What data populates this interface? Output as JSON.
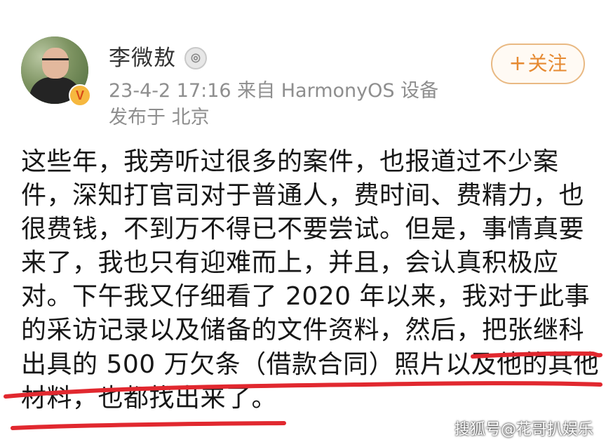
{
  "post": {
    "username": "李微敖",
    "follow_button": {
      "icon": "+",
      "label": "关注"
    },
    "meta": "23-4-2 17:16  来自 HarmonyOS 设备",
    "location": "发布于 北京",
    "content_lines": [
      "这些年，我旁听过很多的案件，也报道过不少案",
      "件，深知打官司对于普通人，费时间、费精力，也",
      "很费钱，不到万不得已不要尝试。但是，事情真要",
      "来了，我也只有迎难而上，并且，会认真积极应",
      "对。下午我又仔细看了 2020 年以来，我对于此事",
      "的采访记录以及储备的文件资料，然后，把张继科",
      "出具的 500 万欠条（借款合同）照片以及他的其他",
      "材料，也都找出来了。"
    ]
  },
  "watermark": "搜狐号@花哥扒娱乐",
  "colors": {
    "underline": "#e1282f",
    "follow_accent": "#e68a32",
    "meta_text": "#8e8e8e",
    "body_text": "#171717"
  },
  "icons": {
    "rank": "silver-medal-icon",
    "verified": "verified-v-icon",
    "follow": "plus-icon"
  }
}
